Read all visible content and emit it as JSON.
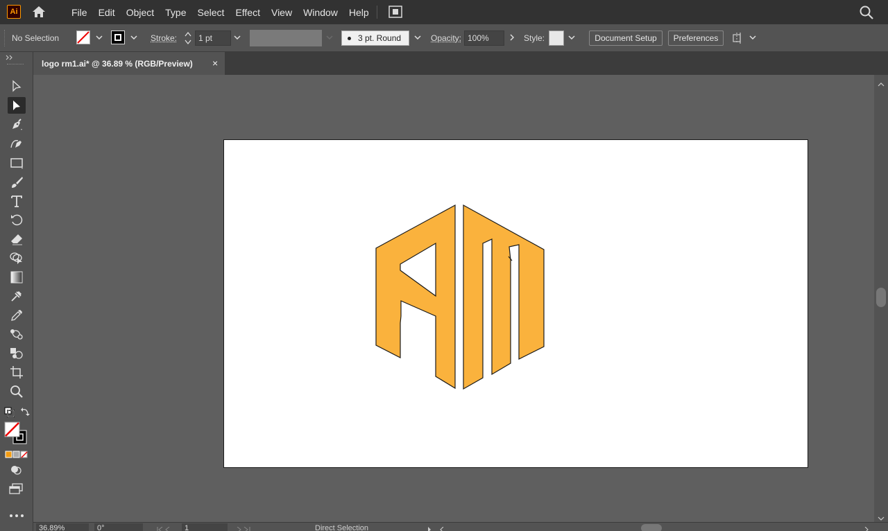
{
  "app": {
    "logo_text": "Ai",
    "brand_color": "#ff9a00"
  },
  "menu": [
    "File",
    "Edit",
    "Object",
    "Type",
    "Select",
    "Effect",
    "View",
    "Window",
    "Help"
  ],
  "control": {
    "selection_status": "No Selection",
    "stroke_label": "Stroke:",
    "stroke_weight": "1 pt",
    "brush_profile": "3 pt. Round",
    "opacity_label": "Opacity:",
    "opacity_value": "100%",
    "style_label": "Style:",
    "document_setup": "Document Setup",
    "preferences": "Preferences"
  },
  "document": {
    "tab_title": "logo rm1.ai* @ 36.89 % (RGB/Preview)",
    "close_symbol": "×",
    "logo_fill": "#fab23d"
  },
  "status": {
    "zoom": "36.89%",
    "rotation": "0°",
    "artboard_number": "1",
    "current_tool": "Direct Selection"
  },
  "icons": [
    "home-icon",
    "arrange-documents-icon",
    "search-icon",
    "selection-tool-icon",
    "direct-selection-tool-icon",
    "pen-tool-icon",
    "curvature-tool-icon",
    "rectangle-tool-icon",
    "paintbrush-tool-icon",
    "type-tool-icon",
    "rotate-tool-icon",
    "eraser-tool-icon",
    "shape-builder-tool-icon",
    "gradient-tool-icon",
    "mesh-tool-icon",
    "eyedropper-tool-icon",
    "blend-tool-icon",
    "symbol-sprayer-tool-icon",
    "artboard-tool-icon",
    "zoom-tool-icon",
    "edit-toolbar-icon"
  ]
}
